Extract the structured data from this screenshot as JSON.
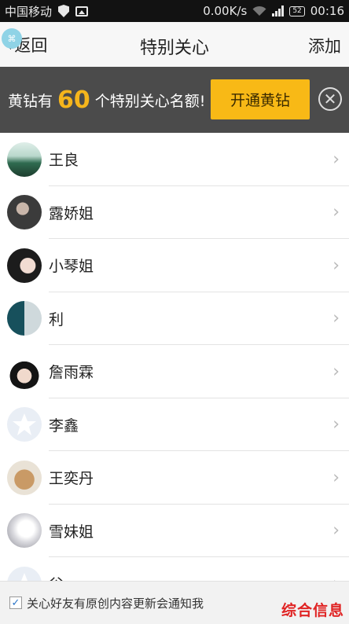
{
  "status_bar": {
    "carrier": "中国移动",
    "speed": "0.00K/s",
    "battery": "52",
    "time": "00:16",
    "icons": [
      "shield-icon",
      "image-icon",
      "wifi-icon",
      "signal-icon",
      "battery-icon"
    ]
  },
  "nav": {
    "back_label": "返回",
    "title": "特别关心",
    "add_label": "添加"
  },
  "promo": {
    "text_before": "黄钻有",
    "count": "60",
    "text_after": "个特别关心名额!",
    "button_label": "开通黄钻",
    "accent_color": "#f8b916"
  },
  "contacts": [
    {
      "name": "王良",
      "avatar": "landscape"
    },
    {
      "name": "露娇姐",
      "avatar": "photo-dark"
    },
    {
      "name": "小琴姐",
      "avatar": "photo-woman"
    },
    {
      "name": "利",
      "avatar": "photo-teal"
    },
    {
      "name": "詹雨霖",
      "avatar": "photo-girl"
    },
    {
      "name": "李鑫",
      "avatar": "default-star"
    },
    {
      "name": "王奕丹",
      "avatar": "photo-dog"
    },
    {
      "name": "雪妹姐",
      "avatar": "photo-light"
    },
    {
      "name": "谷",
      "avatar": "default-star"
    }
  ],
  "footer": {
    "checkbox_checked": true,
    "notify_text": "关心好友有原创内容更新会通知我",
    "watermark": "综合信息"
  }
}
